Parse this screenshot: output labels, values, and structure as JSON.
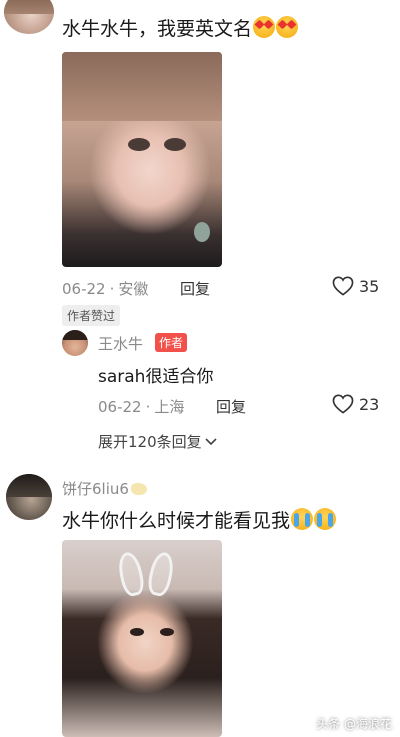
{
  "comment1": {
    "text": "水牛水牛，我要英文名",
    "emojis": [
      "heart-eyes-emoji",
      "heart-eyes-emoji"
    ],
    "date": "06-22",
    "location": "安徽",
    "reply_label": "回复",
    "likes": "35"
  },
  "author_liked_badge": "作者赞过",
  "reply1": {
    "name": "王水牛",
    "author_badge": "作者",
    "text": "sarah很适合你",
    "date": "06-22",
    "location": "上海",
    "reply_label": "回复",
    "likes": "23"
  },
  "expand_label": "展开120条回复",
  "comment2": {
    "user": "饼仔6liu6",
    "text": "水牛你什么时候才能看见我",
    "emojis": [
      "crying-emoji",
      "crying-emoji"
    ]
  },
  "watermark": "头条 @海浪花",
  "colors": {
    "author_badge_bg": "#f2504a",
    "meta_text": "#8a8a8a"
  }
}
